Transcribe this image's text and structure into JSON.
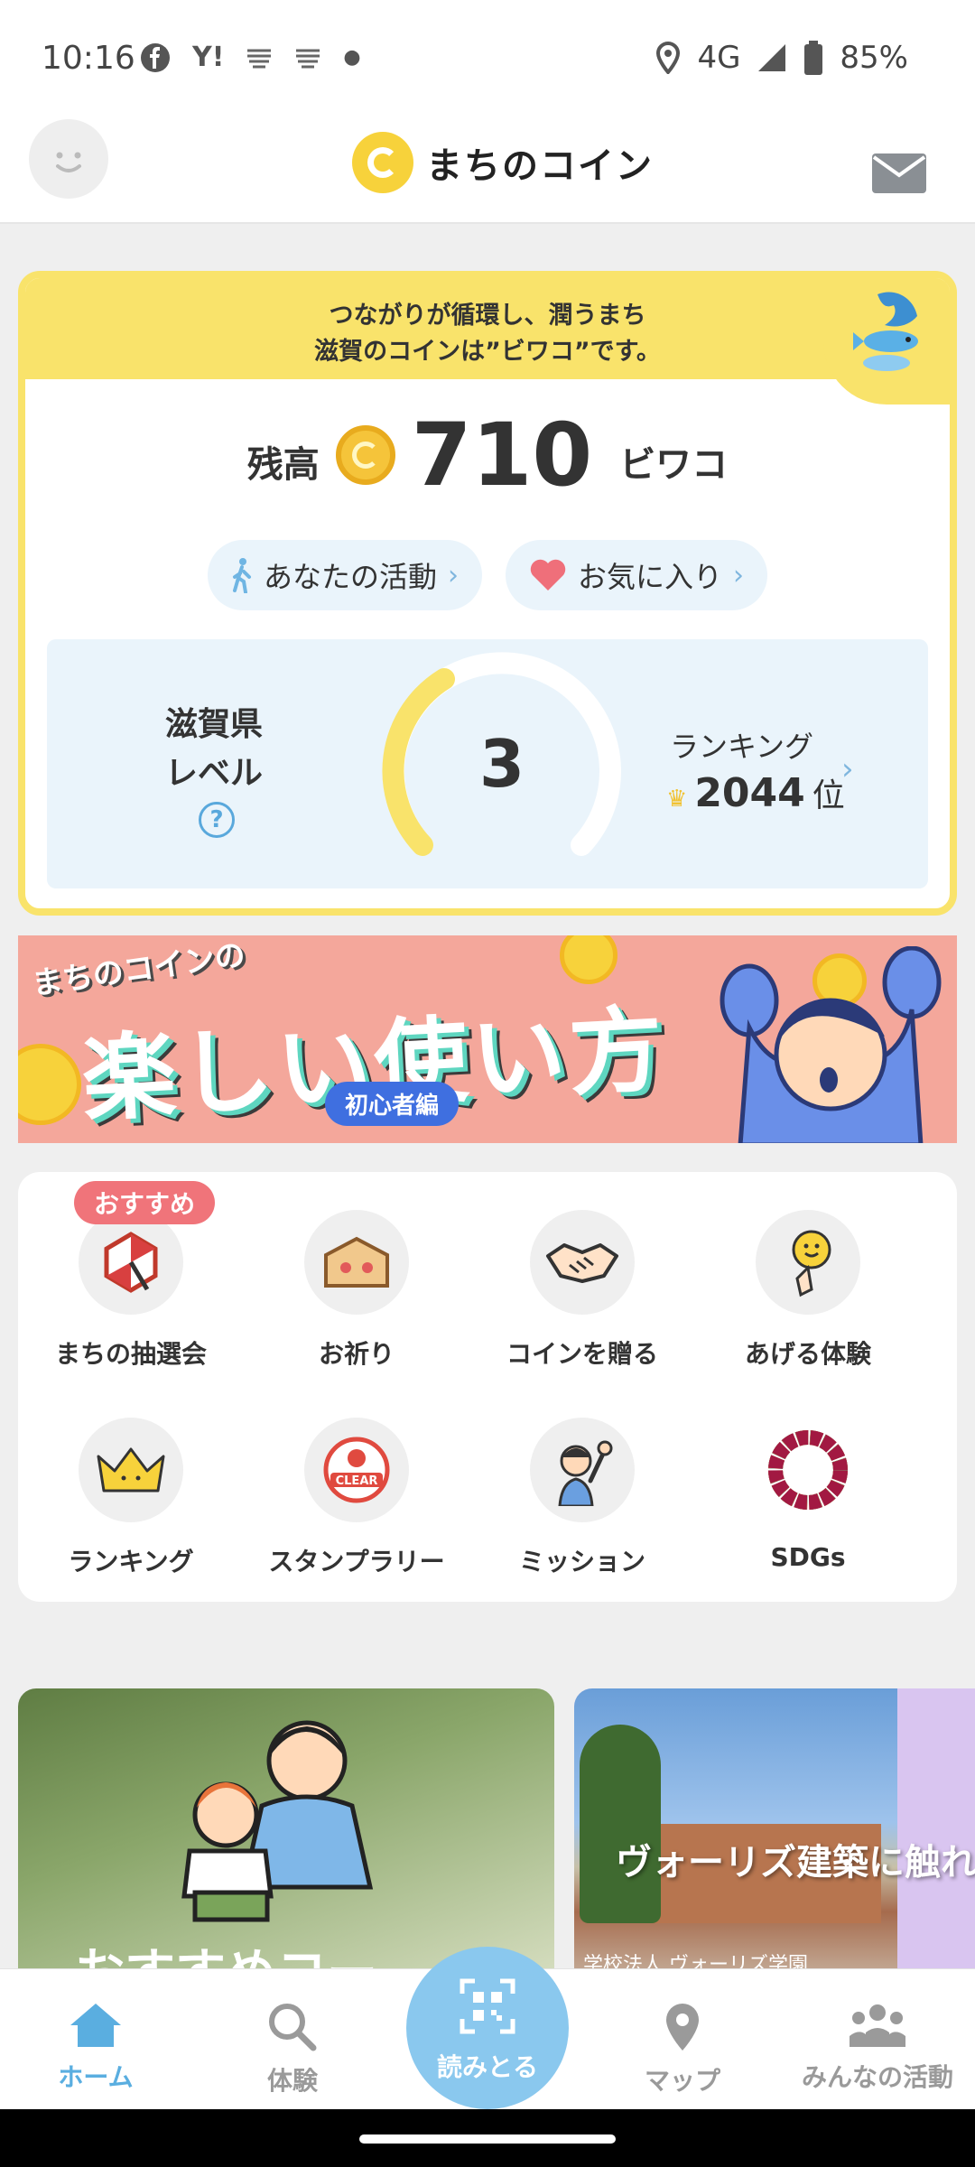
{
  "status_bar": {
    "time": "10:16",
    "notif_icons": [
      "facebook-icon",
      "yahoo-icon",
      "app-icon",
      "app-icon",
      "dot-icon"
    ],
    "network": "4G",
    "battery": "85%"
  },
  "header": {
    "logo_text": "まちのコイン"
  },
  "balance_card": {
    "tagline_1": "つながりが循環し、潤うまち",
    "tagline_2": "滋賀のコインは”ビワコ”です。",
    "balance_label": "残高",
    "balance_amount": "710",
    "balance_unit": "ビワコ",
    "activity_label": "あなたの活動",
    "favorites_label": "お気に入り",
    "level_label_1": "滋賀県",
    "level_label_2": "レベル",
    "level_help": "?",
    "level_value": "3",
    "ranking_label": "ランキング",
    "ranking_value": "2044",
    "ranking_suffix": "位",
    "colors": {
      "accent_yellow": "#f9e36b",
      "light_blue": "#eaf4fb"
    }
  },
  "banner": {
    "small_text": "まちのコインの",
    "big_text": "楽しい使い方",
    "tag": "初心者編"
  },
  "menu": {
    "recommend_badge": "おすすめ",
    "items": [
      {
        "label": "まちの抽選会",
        "icon": "lottery-icon"
      },
      {
        "label": "お祈り",
        "icon": "ema-icon"
      },
      {
        "label": "コインを贈る",
        "icon": "handshake-icon"
      },
      {
        "label": "あげる体験",
        "icon": "smile-balloon-icon"
      },
      {
        "label": "ランキング",
        "icon": "crown-icon"
      },
      {
        "label": "スタンプラリー",
        "icon": "stamp-icon"
      },
      {
        "label": "ミッション",
        "icon": "mission-icon"
      },
      {
        "label": "SDGs",
        "icon": "sdgs-icon"
      }
    ]
  },
  "features": {
    "left_title": "おすすめコー",
    "right_title": "ヴォーリズ建築に触れ",
    "right_sub": "学校法人 ヴォーリズ学園"
  },
  "bottom_nav": {
    "home": "ホーム",
    "experience": "体験",
    "scan": "読みとる",
    "map": "マップ",
    "community": "みんなの活動"
  }
}
